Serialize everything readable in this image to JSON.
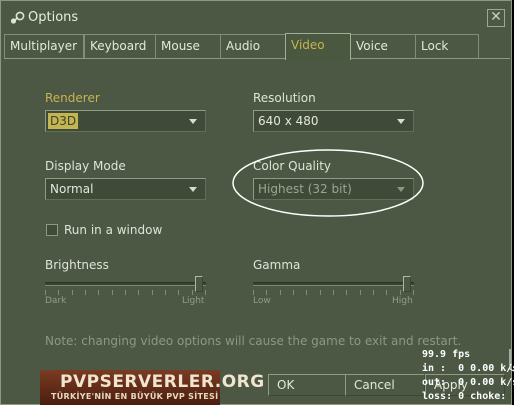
{
  "window": {
    "title": "Options",
    "close_glyph": "✕"
  },
  "tabs": [
    {
      "label": "Multiplayer",
      "active": false
    },
    {
      "label": "Keyboard",
      "active": false
    },
    {
      "label": "Mouse",
      "active": false
    },
    {
      "label": "Audio",
      "active": false
    },
    {
      "label": "Video",
      "active": true
    },
    {
      "label": "Voice",
      "active": false
    },
    {
      "label": "Lock",
      "active": false
    }
  ],
  "video": {
    "renderer": {
      "label": "Renderer",
      "value": "D3D"
    },
    "resolution": {
      "label": "Resolution",
      "value": "640 x 480"
    },
    "display_mode": {
      "label": "Display Mode",
      "value": "Normal"
    },
    "color_quality": {
      "label": "Color Quality",
      "value": "Highest (32 bit)",
      "disabled": true
    },
    "windowed": {
      "label": "Run in a window",
      "checked": false
    },
    "brightness": {
      "label": "Brightness",
      "min_label": "Dark",
      "max_label": "Light",
      "value": 1.0
    },
    "gamma": {
      "label": "Gamma",
      "min_label": "Low",
      "max_label": "High",
      "value": 1.0
    },
    "note": "Note: changing video options will cause the game to exit and restart."
  },
  "buttons": {
    "ok": "OK",
    "cancel": "Cancel",
    "apply": "Apply"
  },
  "overlay": {
    "banner_title": "PVPSERVERLER.ORG",
    "banner_subtitle": "TÜRKİYE'NİN EN BÜYÜK PVP SİTESİ",
    "fps": "99.9 fps",
    "in": "in :  0 0.00 k/s",
    "out": "out:  0 0.00 k/s",
    "loss": "loss: 0 choke:"
  },
  "colors": {
    "accent": "#c4b550",
    "background": "#4c5844",
    "annotation": "#ffffff"
  }
}
